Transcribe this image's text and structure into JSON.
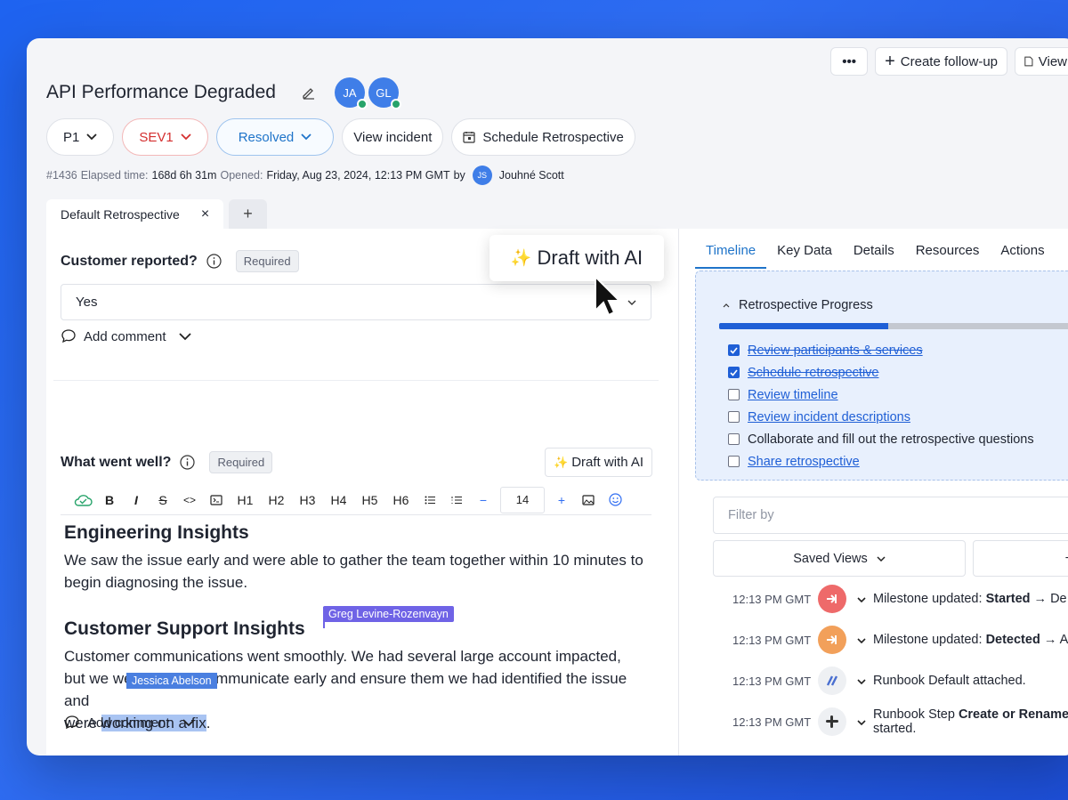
{
  "header": {
    "title": "API Performance Degraded",
    "avatars": [
      {
        "initials": "JA"
      },
      {
        "initials": "GL"
      }
    ],
    "actions": {
      "more": "•••",
      "create_followup": "Create follow-up",
      "view": "View"
    }
  },
  "status": {
    "priority": "P1",
    "severity": "SEV1",
    "state": "Resolved",
    "view_incident": "View incident",
    "schedule": "Schedule Retrospective"
  },
  "meta": {
    "id": "#1436",
    "elapsed_label": "Elapsed time:",
    "elapsed": "168d 6h 31m",
    "opened_label": "Opened:",
    "opened": "Friday, Aug 23, 2024, 12:13 PM GMT",
    "by": "by",
    "user_initials": "JS",
    "user": "Jouhné Scott"
  },
  "doc_tabs": {
    "active": "Default Retrospective",
    "close": "×",
    "add": "+"
  },
  "q1": {
    "label": "Customer reported?",
    "required": "Required",
    "value": "Yes",
    "comment": "Add comment"
  },
  "draft_popup": {
    "icon": "✨",
    "label": "Draft with AI"
  },
  "q2": {
    "label": "What went well?",
    "required": "Required",
    "draft": "Draft with AI",
    "draft_icon": "✨",
    "font_size": "14",
    "comment": "Add comment"
  },
  "toolbar": {
    "bold": "B",
    "italic": "I",
    "strike": "S",
    "code": "<>",
    "h1": "H1",
    "h2": "H2",
    "h3": "H3",
    "h4": "H4",
    "h5": "H5",
    "h6": "H6",
    "minus": "−",
    "plus": "+"
  },
  "content": {
    "h_engineering": "Engineering Insights",
    "p_engineering": "We saw the issue early and were able to gather the team together within 10 minutes to begin diagnosing the issue.",
    "h_support": "Customer Support Insights",
    "p_support_1": "Customer communications went smoothly. We had several large account impacted,",
    "p_support_2a": "but we",
    "p_support_2b": " were able to communicate early and ensure them we had identified the issue and",
    "p_support_3a": "were ",
    "p_support_3b": "working on a fix",
    "p_support_3c": ".",
    "collaborator_greg": "Greg Levine-Rozenvayn",
    "collaborator_jessica": "Jessica Abelson"
  },
  "right_tabs": [
    "Timeline",
    "Key Data",
    "Details",
    "Resources",
    "Actions"
  ],
  "progress": {
    "title": "Retrospective Progress",
    "fraction": 0.47,
    "items": [
      {
        "label": "Review participants & services",
        "checked": true,
        "link": true
      },
      {
        "label": "Schedule retrospective",
        "checked": true,
        "link": true
      },
      {
        "label": "Review timeline",
        "checked": false,
        "link": true
      },
      {
        "label": "Review incident descriptions",
        "checked": false,
        "link": true
      },
      {
        "label": "Collaborate and fill out the retrospective questions",
        "checked": false,
        "link": false
      },
      {
        "label": "Share retrospective",
        "checked": false,
        "link": true
      }
    ]
  },
  "filter": {
    "placeholder": "Filter by",
    "saved_views": "Saved Views",
    "add": "+"
  },
  "timeline": [
    {
      "time": "12:13 PM GMT",
      "prefix": "Milestone updated: ",
      "bold": "Started",
      "suffix": " → De",
      "color": "#ee6a6a"
    },
    {
      "time": "12:13 PM GMT",
      "prefix": "Milestone updated: ",
      "bold": "Detected",
      "suffix": " → A",
      "color": "#f2a05a"
    },
    {
      "time": "12:13 PM GMT",
      "prefix": "Runbook Default attached.",
      "bold": "",
      "suffix": "",
      "color": "#eef0f3"
    },
    {
      "time": "12:13 PM GMT",
      "prefix": "Runbook Step ",
      "bold": "Create or Rename",
      "suffix": "",
      "line2": "started.",
      "color": "#eef0f3"
    }
  ]
}
